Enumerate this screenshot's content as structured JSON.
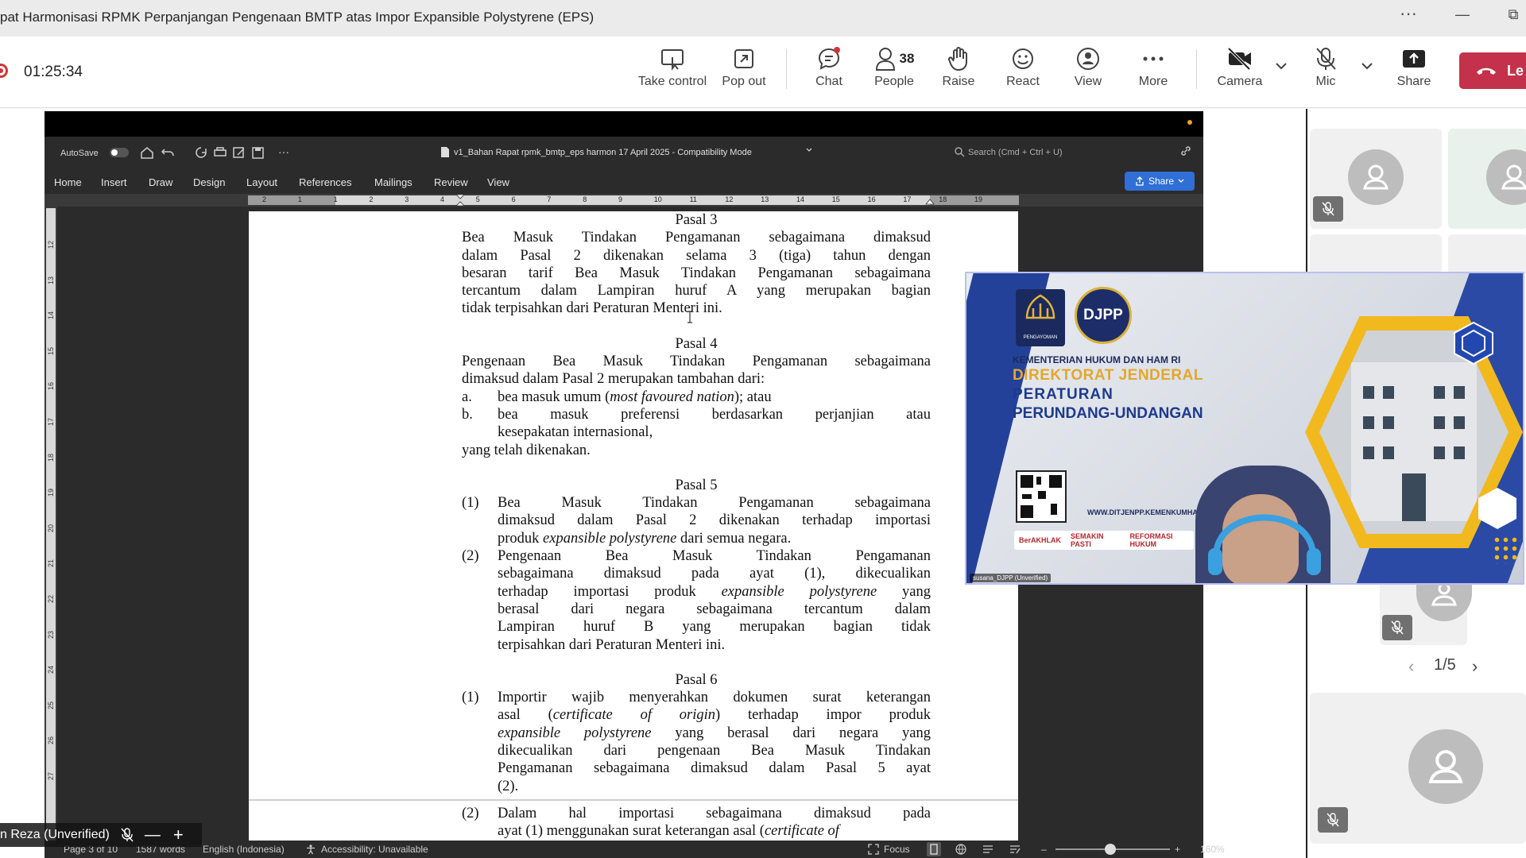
{
  "window": {
    "title": "pat Harmonisasi RPMK Perpanjangan Pengenaan BMTP atas Impor Expansible Polystyrene (EPS)",
    "more": "···",
    "minimize": "—",
    "restore": "⧉"
  },
  "toolbar": {
    "timer": "01:25:34",
    "buttons": {
      "take_control": "Take control",
      "pop_out": "Pop out",
      "chat": "Chat",
      "people": "People",
      "people_count": "38",
      "raise": "Raise",
      "react": "React",
      "view": "View",
      "more": "More",
      "camera": "Camera",
      "mic": "Mic",
      "share": "Share",
      "leave": "Le"
    }
  },
  "word": {
    "autosave": "AutoSave",
    "doc_title": "v1_Bahan Rapat rpmk_bmtp_eps harmon 17 April 2025  -  Compatibility Mode",
    "search_placeholder": "Search (Cmd + Ctrl + U)",
    "share_label": "Share",
    "tabs": [
      "Home",
      "Insert",
      "Draw",
      "Design",
      "Layout",
      "References",
      "Mailings",
      "Review",
      "View"
    ],
    "ruler_numbers": [
      "2",
      "1",
      "1",
      "2",
      "3",
      "4",
      "5",
      "6",
      "7",
      "8",
      "9",
      "10",
      "11",
      "12",
      "13",
      "14",
      "15",
      "16",
      "17",
      "18",
      "19"
    ],
    "vruler_numbers": [
      "12",
      "13",
      "14",
      "15",
      "16",
      "17",
      "18",
      "19",
      "20",
      "21",
      "22",
      "23",
      "24",
      "25",
      "26",
      "27"
    ],
    "status": {
      "page": "Page 3 of 10",
      "words": "1587 words",
      "language": "English (Indonesia)",
      "accessibility": "Accessibility: Unavailable",
      "focus": "Focus",
      "zoom": "160%"
    }
  },
  "document": {
    "pasal3_title": "Pasal 3",
    "pasal3_l1": "Bea Masuk Tindakan Pengamanan sebagaimana dimaksud",
    "pasal3_l2": "dalam Pasal 2 dikenakan selama 3 (tiga) tahun dengan",
    "pasal3_l3": "besaran tarif Bea Masuk Tindakan Pengamanan sebagaimana",
    "pasal3_l4": "tercantum dalam Lampiran huruf A yang merupakan bagian",
    "pasal3_l5": "tidak terpisahkan dari Peraturan Menteri ini.",
    "pasal4_title": "Pasal 4",
    "pasal4_l1": "Pengenaan Bea Masuk Tindakan Pengamanan sebagaimana",
    "pasal4_l2": "dimaksud dalam Pasal 2 merupakan tambahan dari:",
    "pasal4_a_num": "a.",
    "pasal4_a_pre": "bea masuk umum (",
    "pasal4_a_it": "most favoured nation",
    "pasal4_a_post": "); atau",
    "pasal4_b_num": "b.",
    "pasal4_b_l1": "bea masuk preferensi berdasarkan perjanjian atau",
    "pasal4_b_l2": "kesepakatan internasional,",
    "pasal4_end": "yang telah dikenakan.",
    "pasal5_title": "Pasal 5",
    "pasal5_1_num": "(1)",
    "pasal5_1_l1": "Bea Masuk Tindakan Pengamanan sebagaimana",
    "pasal5_1_l2": "dimaksud dalam Pasal 2 dikenakan terhadap importasi",
    "pasal5_1_l3_pre": "produk ",
    "pasal5_1_l3_it": "expansible polystyrene",
    "pasal5_1_l3_post": " dari semua negara.",
    "pasal5_2_num": "(2)",
    "pasal5_2_l1": "Pengenaan Bea Masuk Tindakan Pengamanan",
    "pasal5_2_l2": "sebagaimana dimaksud pada ayat (1), dikecualikan",
    "pasal5_2_l3_pre": "terhadap importasi produk ",
    "pasal5_2_l3_it": "expansible polystyrene",
    "pasal5_2_l3_post": " yang",
    "pasal5_2_l4": "berasal dari negara sebagaimana tercantum dalam",
    "pasal5_2_l5": "Lampiran huruf B yang merupakan bagian tidak",
    "pasal5_2_l6": "terpisahkan dari Peraturan Menteri ini.",
    "pasal6_title": "Pasal 6",
    "pasal6_1_num": "(1)",
    "pasal6_1_l1": "Importir wajib menyerahkan dokumen surat keterangan",
    "pasal6_1_l2_pre": "asal (",
    "pasal6_1_l2_it": "certificate of origin",
    "pasal6_1_l2_post": ") terhadap impor produk",
    "pasal6_1_l3_it": "expansible polystyrene",
    "pasal6_1_l3_post": " yang berasal dari negara yang",
    "pasal6_1_l4": "dikecualikan dari pengenaan Bea Masuk Tindakan",
    "pasal6_1_l5": "Pengamanan sebagaimana dimaksud dalam Pasal 5 ayat",
    "pasal6_1_l6": "(2).",
    "pasal6_2_num": "(2)",
    "pasal6_2_l1": "Dalam hal importasi sebagaimana dimaksud pada",
    "pasal6_2_l2_pre": "ayat (1) menggunakan surat keterangan asal (",
    "pasal6_2_l2_it": "certificate of"
  },
  "self_view": {
    "name": "n Reza (Unverified)"
  },
  "video": {
    "djpp": "DJPP",
    "pengayoman": "PENGAYOMAN",
    "ministry": "KEMENTERIAN HUKUM DAN HAM RI",
    "line1": "DIREKTORAT JENDERAL",
    "line2": "PERATURAN",
    "line3": "PERUNDANG-UNDANGAN",
    "website": "WWW.DITJENPP.KEMENKUMHAM",
    "badge1": "BerAKHLAK",
    "badge2": "SEMAKIN PASTI",
    "badge3": "REFORMASI HUKUM",
    "participant": "susana_DJPP (Unverified)"
  },
  "rail": {
    "pager": "1/5",
    "prev": "‹",
    "next": "›"
  }
}
